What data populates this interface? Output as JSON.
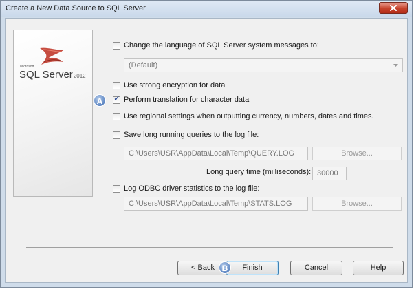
{
  "window": {
    "title": "Create a New Data Source to SQL Server"
  },
  "sidebar": {
    "brand_small": "Microsoft",
    "brand": "SQL Server",
    "brand_year": "2012"
  },
  "options": {
    "change_language": {
      "label": "Change the language of SQL Server system messages to:",
      "checked": false
    },
    "language_select": {
      "value": "(Default)"
    },
    "strong_encryption": {
      "label": "Use strong encryption for data",
      "checked": false
    },
    "perform_translation": {
      "label": "Perform translation for character data",
      "checked": true
    },
    "regional_settings": {
      "label": "Use regional settings when outputting currency, numbers, dates and times.",
      "checked": false
    },
    "long_queries": {
      "label": "Save long running queries to the log file:",
      "checked": false
    },
    "query_log_path": {
      "value": "C:\\Users\\USR\\AppData\\Local\\Temp\\QUERY.LOG"
    },
    "query_browse": {
      "label": "Browse..."
    },
    "long_query_time": {
      "label": "Long query time (milliseconds):",
      "value": "30000"
    },
    "odbc_stats": {
      "label": "Log ODBC driver statistics to the log file:",
      "checked": false
    },
    "stats_log_path": {
      "value": "C:\\Users\\USR\\AppData\\Local\\Temp\\STATS.LOG"
    },
    "stats_browse": {
      "label": "Browse..."
    }
  },
  "buttons": {
    "back": "< Back",
    "finish": "Finish",
    "cancel": "Cancel",
    "help": "Help"
  },
  "callouts": {
    "a": "A",
    "b": "B"
  },
  "colors": {
    "callout": "#5d86c3",
    "close_button": "#c7432c",
    "logo_red": "#c0392b"
  }
}
